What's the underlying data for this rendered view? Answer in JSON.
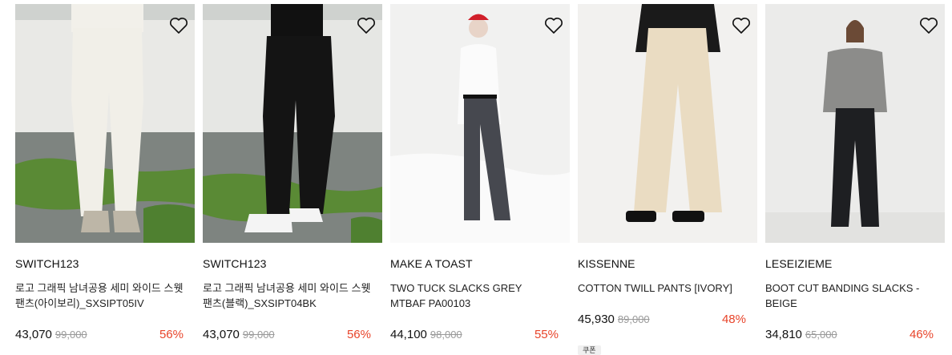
{
  "products": [
    {
      "brand": "SWITCH123",
      "name": "로고 그래픽 남녀공용 세미 와이드 스웻 팬츠(아이보리)_SXSIPT05IV",
      "price": "43,070",
      "original_price": "99,000",
      "discount": "56%"
    },
    {
      "brand": "SWITCH123",
      "name": "로고 그래픽 남녀공용 세미 와이드 스웻 팬츠(블랙)_SXSIPT04BK",
      "price": "43,070",
      "original_price": "99,000",
      "discount": "56%"
    },
    {
      "brand": "MAKE A TOAST",
      "name": "TWO TUCK SLACKS GREY MTBAF PA00103",
      "price": "44,100",
      "original_price": "98,000",
      "discount": "55%"
    },
    {
      "brand": "KISSENNE",
      "name": "COTTON TWILL PANTS [IVORY]",
      "price": "45,930",
      "original_price": "89,000",
      "discount": "48%",
      "badge": "쿠폰"
    },
    {
      "brand": "LESEIZIEME",
      "name": "BOOT CUT BANDING SLACKS - BEIGE",
      "price": "34,810",
      "original_price": "65,000",
      "discount": "46%"
    }
  ],
  "icons": {
    "wishlist": "heart-outline-icon"
  },
  "colors": {
    "discount": "#e8442a",
    "original_price": "#9a9a9a",
    "text": "#111111"
  }
}
